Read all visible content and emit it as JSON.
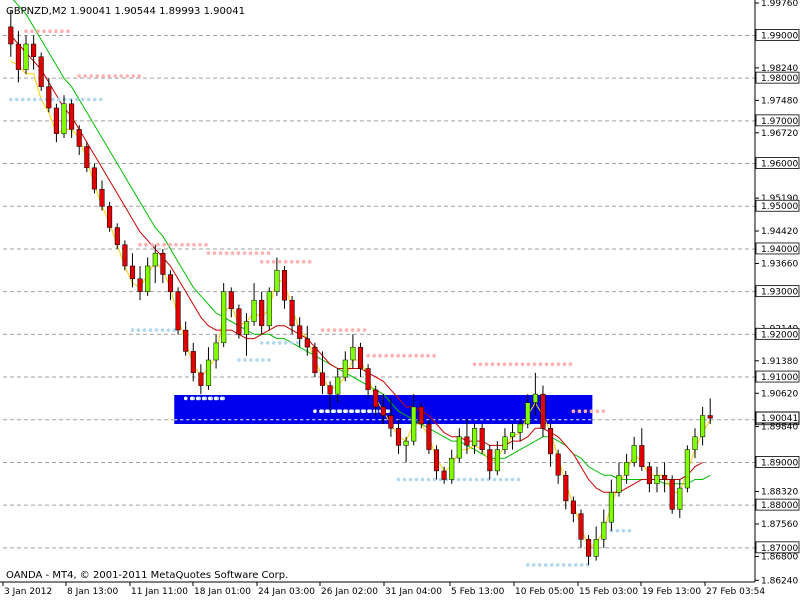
{
  "header": {
    "symbol_tf": "GBPNZD,M2",
    "ohlc": "1.90041 1.90544 1.89993 1.90041"
  },
  "footer": {
    "copyright": "OANDA - MT4, © 2001-2011 MetaQuotes Software Corp."
  },
  "colors": {
    "bull": "#80ff00",
    "bear": "#e00000",
    "wick": "#000000",
    "ma_red": "#cc0000",
    "ma_green": "#00c000",
    "ma_yellow": "#ffcc00",
    "dots_pink": "#ffb0b0",
    "dots_blue": "#b0d8f0",
    "dots_white": "#ffffff",
    "zone": "#0000ee",
    "grid": "#a0a0a0",
    "price_box": "#ffffff"
  },
  "chart_data": {
    "type": "candlestick",
    "ylim": [
      1.862,
      1.9976
    ],
    "price_ticks": [
      1.9976,
      1.99,
      1.9824,
      1.98,
      1.9748,
      1.97,
      1.9672,
      1.96,
      1.9519,
      1.95,
      1.9442,
      1.94,
      1.9366,
      1.93,
      1.9214,
      1.92,
      1.9138,
      1.91,
      1.9062,
      1.9,
      1.8984,
      1.89,
      1.8832,
      1.88,
      1.8756,
      1.87,
      1.868,
      1.8624
    ],
    "price_tick_labels": [
      "1.99760",
      "1.99000",
      "1.98240",
      "1.98000",
      "1.97480",
      "1.97000",
      "1.96720",
      "1.96000",
      "1.95190",
      "1.95000",
      "1.94420",
      "1.94000",
      "1.93660",
      "1.93000",
      "1.92140",
      "1.92000",
      "1.91380",
      "1.91000",
      "1.90620",
      "1.90000",
      "1.89840",
      "1.89000",
      "1.88320",
      "1.88000",
      "1.87560",
      "1.87000",
      "1.86800",
      "1.86240"
    ],
    "grid_levels": [
      1.99,
      1.98,
      1.97,
      1.96,
      1.95,
      1.94,
      1.93,
      1.92,
      1.91,
      1.9,
      1.89,
      1.88,
      1.87
    ],
    "highlighted_ticks": [
      "1.99000",
      "1.98000",
      "1.97000",
      "1.96000",
      "1.95000",
      "1.94000",
      "1.93000",
      "1.92000",
      "1.91000",
      "1.90000",
      "1.89000",
      "1.88000",
      "1.87000"
    ],
    "current_price": "1.90041",
    "x_labels": [
      "3 Jan 2012",
      "8 Jan 13:00",
      "11 Jan 11:00",
      "18 Jan 01:00",
      "24 Jan 03:00",
      "26 Jan 02:00",
      "31 Jan 04:00",
      "5 Feb 13:00",
      "10 Feb 05:00",
      "15 Feb 03:00",
      "19 Feb 13:00",
      "27 Feb 03:54"
    ],
    "candles": [
      [
        1.992,
        1.996,
        1.985,
        1.988
      ],
      [
        1.988,
        1.991,
        1.979,
        1.982
      ],
      [
        1.982,
        1.99,
        1.981,
        1.988
      ],
      [
        1.988,
        1.99,
        1.982,
        1.985
      ],
      [
        1.985,
        1.986,
        1.977,
        1.978
      ],
      [
        1.978,
        1.98,
        1.972,
        1.973
      ],
      [
        1.973,
        1.974,
        1.965,
        1.967
      ],
      [
        1.967,
        1.976,
        1.966,
        1.974
      ],
      [
        1.974,
        1.975,
        1.966,
        1.968
      ],
      [
        1.968,
        1.969,
        1.962,
        1.964
      ],
      [
        1.964,
        1.965,
        1.958,
        1.959
      ],
      [
        1.959,
        1.96,
        1.953,
        1.954
      ],
      [
        1.954,
        1.956,
        1.949,
        1.95
      ],
      [
        1.95,
        1.951,
        1.944,
        1.945
      ],
      [
        1.945,
        1.946,
        1.94,
        1.941
      ],
      [
        1.941,
        1.942,
        1.935,
        1.936
      ],
      [
        1.936,
        1.939,
        1.931,
        1.933
      ],
      [
        1.933,
        1.936,
        1.928,
        1.93
      ],
      [
        1.93,
        1.938,
        1.929,
        1.936
      ],
      [
        1.936,
        1.941,
        1.932,
        1.939
      ],
      [
        1.939,
        1.94,
        1.932,
        1.934
      ],
      [
        1.934,
        1.935,
        1.928,
        1.93
      ],
      [
        1.93,
        1.931,
        1.92,
        1.921
      ],
      [
        1.921,
        1.923,
        1.915,
        1.916
      ],
      [
        1.916,
        1.918,
        1.909,
        1.911
      ],
      [
        1.911,
        1.913,
        1.906,
        1.908
      ],
      [
        1.908,
        1.917,
        1.907,
        1.914
      ],
      [
        1.914,
        1.92,
        1.912,
        1.918
      ],
      [
        1.918,
        1.932,
        1.917,
        1.93
      ],
      [
        1.93,
        1.931,
        1.924,
        1.926
      ],
      [
        1.926,
        1.927,
        1.919,
        1.92
      ],
      [
        1.92,
        1.925,
        1.915,
        1.923
      ],
      [
        1.923,
        1.932,
        1.922,
        1.928
      ],
      [
        1.928,
        1.93,
        1.92,
        1.922
      ],
      [
        1.922,
        1.931,
        1.921,
        1.93
      ],
      [
        1.93,
        1.938,
        1.929,
        1.935
      ],
      [
        1.935,
        1.936,
        1.926,
        1.928
      ],
      [
        1.928,
        1.929,
        1.92,
        1.922
      ],
      [
        1.922,
        1.924,
        1.917,
        1.919
      ],
      [
        1.919,
        1.922,
        1.915,
        1.917
      ],
      [
        1.917,
        1.918,
        1.91,
        1.911
      ],
      [
        1.911,
        1.916,
        1.906,
        1.908
      ],
      [
        1.908,
        1.909,
        1.902,
        1.906
      ],
      [
        1.906,
        1.912,
        1.904,
        1.91
      ],
      [
        1.91,
        1.916,
        1.909,
        1.914
      ],
      [
        1.914,
        1.92,
        1.912,
        1.917
      ],
      [
        1.917,
        1.918,
        1.91,
        1.912
      ],
      [
        1.912,
        1.913,
        1.905,
        1.907
      ],
      [
        1.907,
        1.908,
        1.901,
        1.903
      ],
      [
        1.903,
        1.906,
        1.899,
        1.901
      ],
      [
        1.901,
        1.905,
        1.896,
        1.898
      ],
      [
        1.898,
        1.9,
        1.892,
        1.894
      ],
      [
        1.894,
        1.896,
        1.89,
        1.895
      ],
      [
        1.895,
        1.906,
        1.894,
        1.903
      ],
      [
        1.903,
        1.904,
        1.898,
        1.899
      ],
      [
        1.899,
        1.9,
        1.892,
        1.893
      ],
      [
        1.893,
        1.894,
        1.886,
        1.888
      ],
      [
        1.888,
        1.889,
        1.885,
        1.886
      ],
      [
        1.886,
        1.893,
        1.885,
        1.891
      ],
      [
        1.891,
        1.898,
        1.89,
        1.896
      ],
      [
        1.896,
        1.9,
        1.892,
        1.894
      ],
      [
        1.894,
        1.899,
        1.892,
        1.898
      ],
      [
        1.898,
        1.899,
        1.892,
        1.893
      ],
      [
        1.893,
        1.894,
        1.886,
        1.888
      ],
      [
        1.888,
        1.895,
        1.887,
        1.893
      ],
      [
        1.893,
        1.898,
        1.892,
        1.896
      ],
      [
        1.896,
        1.899,
        1.893,
        1.897
      ],
      [
        1.897,
        1.9,
        1.895,
        1.899
      ],
      [
        1.899,
        1.906,
        1.898,
        1.904
      ],
      [
        1.904,
        1.911,
        1.901,
        1.906
      ],
      [
        1.906,
        1.908,
        1.896,
        1.898
      ],
      [
        1.898,
        1.899,
        1.889,
        1.892
      ],
      [
        1.892,
        1.893,
        1.885,
        1.887
      ],
      [
        1.887,
        1.888,
        1.879,
        1.881
      ],
      [
        1.881,
        1.882,
        1.876,
        1.878
      ],
      [
        1.878,
        1.879,
        1.87,
        1.872
      ],
      [
        1.872,
        1.873,
        1.866,
        1.868
      ],
      [
        1.868,
        1.875,
        1.867,
        1.872
      ],
      [
        1.872,
        1.879,
        1.87,
        1.876
      ],
      [
        1.876,
        1.886,
        1.874,
        1.883
      ],
      [
        1.883,
        1.89,
        1.882,
        1.887
      ],
      [
        1.887,
        1.892,
        1.885,
        1.89
      ],
      [
        1.89,
        1.896,
        1.889,
        1.894
      ],
      [
        1.894,
        1.898,
        1.888,
        1.889
      ],
      [
        1.889,
        1.89,
        1.883,
        1.885
      ],
      [
        1.885,
        1.889,
        1.883,
        1.887
      ],
      [
        1.887,
        1.89,
        1.883,
        1.886
      ],
      [
        1.886,
        1.887,
        1.878,
        1.879
      ],
      [
        1.879,
        1.886,
        1.877,
        1.884
      ],
      [
        1.884,
        1.894,
        1.883,
        1.893
      ],
      [
        1.893,
        1.898,
        1.891,
        1.896
      ],
      [
        1.896,
        1.903,
        1.894,
        1.901
      ],
      [
        1.901,
        1.905,
        1.899,
        1.9004
      ]
    ],
    "ma_red": [
      1.99,
      1.988,
      1.986,
      1.984,
      1.982,
      1.979,
      1.976,
      1.973,
      1.971,
      1.968,
      1.965,
      1.962,
      1.959,
      1.956,
      1.953,
      1.95,
      1.947,
      1.944,
      1.942,
      1.94,
      1.938,
      1.936,
      1.933,
      1.93,
      1.927,
      1.924,
      1.922,
      1.921,
      1.921,
      1.921,
      1.92,
      1.919,
      1.919,
      1.92,
      1.921,
      1.922,
      1.922,
      1.921,
      1.92,
      1.919,
      1.917,
      1.915,
      1.913,
      1.912,
      1.912,
      1.912,
      1.912,
      1.911,
      1.91,
      1.909,
      1.907,
      1.905,
      1.903,
      1.903,
      1.902,
      1.901,
      1.899,
      1.897,
      1.896,
      1.896,
      1.895,
      1.895,
      1.895,
      1.894,
      1.894,
      1.894,
      1.895,
      1.895,
      1.896,
      1.898,
      1.898,
      1.897,
      1.896,
      1.894,
      1.892,
      1.889,
      1.886,
      1.884,
      1.883,
      1.883,
      1.883,
      1.884,
      1.885,
      1.886,
      1.886,
      1.886,
      1.886,
      1.886,
      1.886,
      1.887,
      1.889,
      1.89
    ],
    "ma_green": [
      1.999,
      1.997,
      1.995,
      1.992,
      1.989,
      1.986,
      1.983,
      1.98,
      1.978,
      1.975,
      1.972,
      1.969,
      1.966,
      1.963,
      1.96,
      1.957,
      1.954,
      1.951,
      1.948,
      1.945,
      1.943,
      1.94,
      1.937,
      1.934,
      1.931,
      1.929,
      1.927,
      1.925,
      1.924,
      1.923,
      1.922,
      1.921,
      1.92,
      1.92,
      1.92,
      1.919,
      1.919,
      1.918,
      1.917,
      1.916,
      1.915,
      1.914,
      1.913,
      1.912,
      1.911,
      1.91,
      1.909,
      1.908,
      1.907,
      1.906,
      1.904,
      1.902,
      1.901,
      1.9,
      1.899,
      1.898,
      1.897,
      1.896,
      1.895,
      1.895,
      1.894,
      1.893,
      1.892,
      1.891,
      1.891,
      1.891,
      1.892,
      1.893,
      1.894,
      1.895,
      1.896,
      1.896,
      1.895,
      1.894,
      1.892,
      1.891,
      1.889,
      1.888,
      1.887,
      1.887,
      1.886,
      1.886,
      1.886,
      1.886,
      1.886,
      1.886,
      1.885,
      1.885,
      1.885,
      1.885,
      1.886,
      1.886,
      1.887
    ],
    "ma_yellow": [
      1.984,
      1.983,
      1.981,
      1.981,
      1.975,
      1.972,
      1.967,
      1.968,
      1.968,
      1.966,
      1.961,
      1.955,
      1.95,
      1.946,
      1.941,
      1.936,
      1.932,
      1.931,
      1.934,
      1.937,
      1.935,
      1.931,
      1.924,
      1.918,
      1.913,
      1.91,
      1.912,
      1.915,
      1.925,
      1.927,
      1.922,
      1.923,
      1.925,
      1.924,
      1.926,
      1.933,
      1.932,
      1.926,
      1.921,
      1.919,
      1.914,
      1.91,
      1.907,
      1.908,
      1.91,
      1.914,
      1.914,
      1.91,
      1.905,
      1.902,
      1.899,
      1.896,
      1.895,
      1.899,
      1.899,
      1.896,
      1.891,
      1.888,
      1.889,
      1.893,
      1.893,
      1.894,
      1.893,
      1.89,
      1.891,
      1.894,
      1.896,
      1.897,
      1.901,
      1.904,
      1.901,
      1.897,
      1.891,
      1.885,
      1.88,
      1.875,
      1.87,
      1.871,
      1.874,
      1.88,
      1.885,
      1.888,
      1.892,
      1.89,
      1.887,
      1.887,
      1.887,
      1.883,
      1.883,
      1.888,
      1.893,
      1.897,
      1.9
    ],
    "pink_levels": [
      [
        1.991,
        2,
        8
      ],
      [
        1.9805,
        9,
        17
      ],
      [
        1.941,
        17,
        26
      ],
      [
        1.939,
        26,
        34
      ],
      [
        1.937,
        33,
        40
      ],
      [
        1.921,
        41,
        47
      ],
      [
        1.915,
        47,
        56
      ],
      [
        1.913,
        61,
        74
      ],
      [
        1.902,
        74,
        78
      ]
    ],
    "blue_levels": [
      [
        1.975,
        0,
        12
      ],
      [
        1.921,
        16,
        22
      ],
      [
        1.914,
        30,
        34
      ],
      [
        1.918,
        33,
        38
      ],
      [
        1.905,
        24,
        28
      ],
      [
        1.902,
        41,
        50
      ],
      [
        1.886,
        51,
        67
      ],
      [
        1.866,
        68,
        76
      ],
      [
        1.874,
        79,
        82
      ]
    ],
    "white_levels": [
      [
        1.905,
        23,
        28
      ],
      [
        1.902,
        40,
        50
      ]
    ],
    "zone": {
      "top": 1.9058,
      "bottom": 1.899,
      "start_index": 22,
      "end_index": 76
    },
    "zone_dashed_level": 1.9
  }
}
